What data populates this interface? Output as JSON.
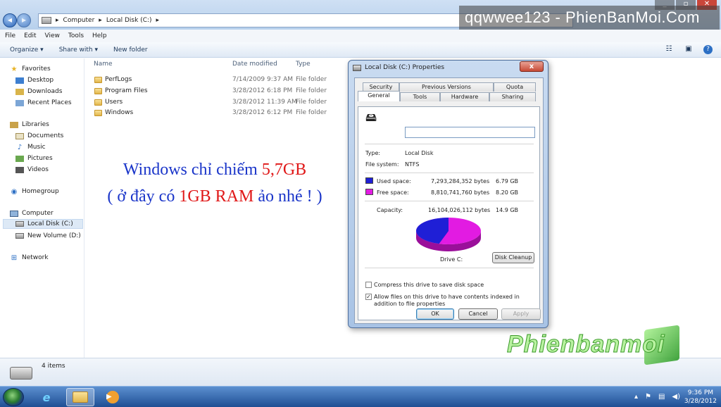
{
  "watermark": "qqwwee123 - PhienBanMoi.Com",
  "address": {
    "parts": [
      "Computer",
      "Local Disk (C:)"
    ],
    "sep": "▸"
  },
  "menu": [
    "File",
    "Edit",
    "View",
    "Tools",
    "Help"
  ],
  "toolbar": {
    "organize": "Organize ▾",
    "share": "Share with ▾",
    "new_folder": "New folder"
  },
  "nav": {
    "favorites": "Favorites",
    "desktop": "Desktop",
    "downloads": "Downloads",
    "recent": "Recent Places",
    "libraries": "Libraries",
    "documents": "Documents",
    "music": "Music",
    "pictures": "Pictures",
    "videos": "Videos",
    "homegroup": "Homegroup",
    "computer": "Computer",
    "local_disk": "Local Disk (C:)",
    "new_volume": "New Volume (D:)",
    "network": "Network"
  },
  "columns": {
    "name": "Name",
    "date": "Date modified",
    "type": "Type"
  },
  "files": [
    {
      "name": "PerfLogs",
      "date": "7/14/2009 9:37 AM",
      "type": "File folder"
    },
    {
      "name": "Program Files",
      "date": "3/28/2012 6:18 PM",
      "type": "File folder"
    },
    {
      "name": "Users",
      "date": "3/28/2012 11:39 AM",
      "type": "File folder"
    },
    {
      "name": "Windows",
      "date": "3/28/2012 6:12 PM",
      "type": "File folder"
    }
  ],
  "note": {
    "line1a": "Windows chỉ chiếm ",
    "line1b": "5,7GB",
    "line2a": "( ở đây có ",
    "line2b": "1GB RAM",
    "line2c": " ảo nhé ! )"
  },
  "status": {
    "count": "4 items"
  },
  "logo": "Phienbanmoi",
  "dialog": {
    "title": "Local Disk (C:) Properties",
    "close": "x",
    "tabs_top": [
      "Security",
      "Previous Versions",
      "Quota"
    ],
    "tabs_bottom": [
      "General",
      "Tools",
      "Hardware",
      "Sharing"
    ],
    "type_label": "Type:",
    "type_value": "Local Disk",
    "fs_label": "File system:",
    "fs_value": "NTFS",
    "used_label": "Used space:",
    "used_bytes": "7,293,284,352 bytes",
    "used_gb": "6.79 GB",
    "free_label": "Free space:",
    "free_bytes": "8,810,741,760 bytes",
    "free_gb": "8.20 GB",
    "cap_label": "Capacity:",
    "cap_bytes": "16,104,026,112 bytes",
    "cap_gb": "14.9 GB",
    "drive_label": "Drive C:",
    "cleanup": "Disk Cleanup",
    "compress": "Compress this drive to save disk space",
    "index": "Allow files on this drive to have contents indexed in addition to file properties",
    "ok": "OK",
    "cancel": "Cancel",
    "apply": "Apply",
    "colors": {
      "used": "#1f1fd6",
      "free": "#e21be2"
    },
    "used_fraction": 0.453
  },
  "clock": {
    "time": "9:36 PM",
    "date": "3/28/2012"
  }
}
